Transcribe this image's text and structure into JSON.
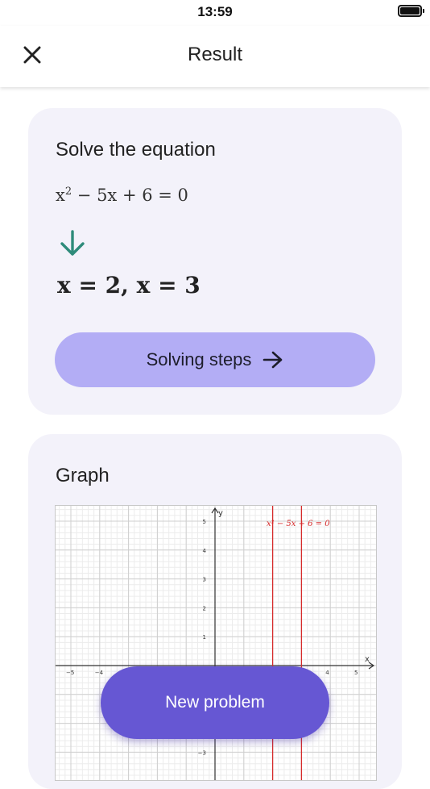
{
  "status_bar": {
    "time": "13:59"
  },
  "nav": {
    "title": "Result",
    "close_icon": "close-icon"
  },
  "result_card": {
    "title": "Solve the equation",
    "equation_parts": {
      "base": "x",
      "exponent": "2",
      "rest": " − 5x + 6 = 0"
    },
    "arrow_icon": "arrow-down-icon",
    "arrow_color": "#2e8b7a",
    "answer": "x = 2, x = 3",
    "steps_button_label": "Solving steps",
    "steps_button_color": "#b3adf5"
  },
  "graph_card": {
    "title": "Graph",
    "x_axis_label": "x",
    "y_axis_label": "y",
    "x_ticks": [
      "−5",
      "−4",
      "4",
      "5"
    ],
    "y_ticks": [
      "5",
      "4",
      "3",
      "2",
      "1",
      "−3"
    ],
    "curve_label": "x² − 5x + 6 = 0",
    "curve_color": "#d62b2b",
    "solution_lines_x": [
      2,
      3
    ]
  },
  "new_problem_button": {
    "label": "New problem",
    "color": "#6657d3"
  }
}
